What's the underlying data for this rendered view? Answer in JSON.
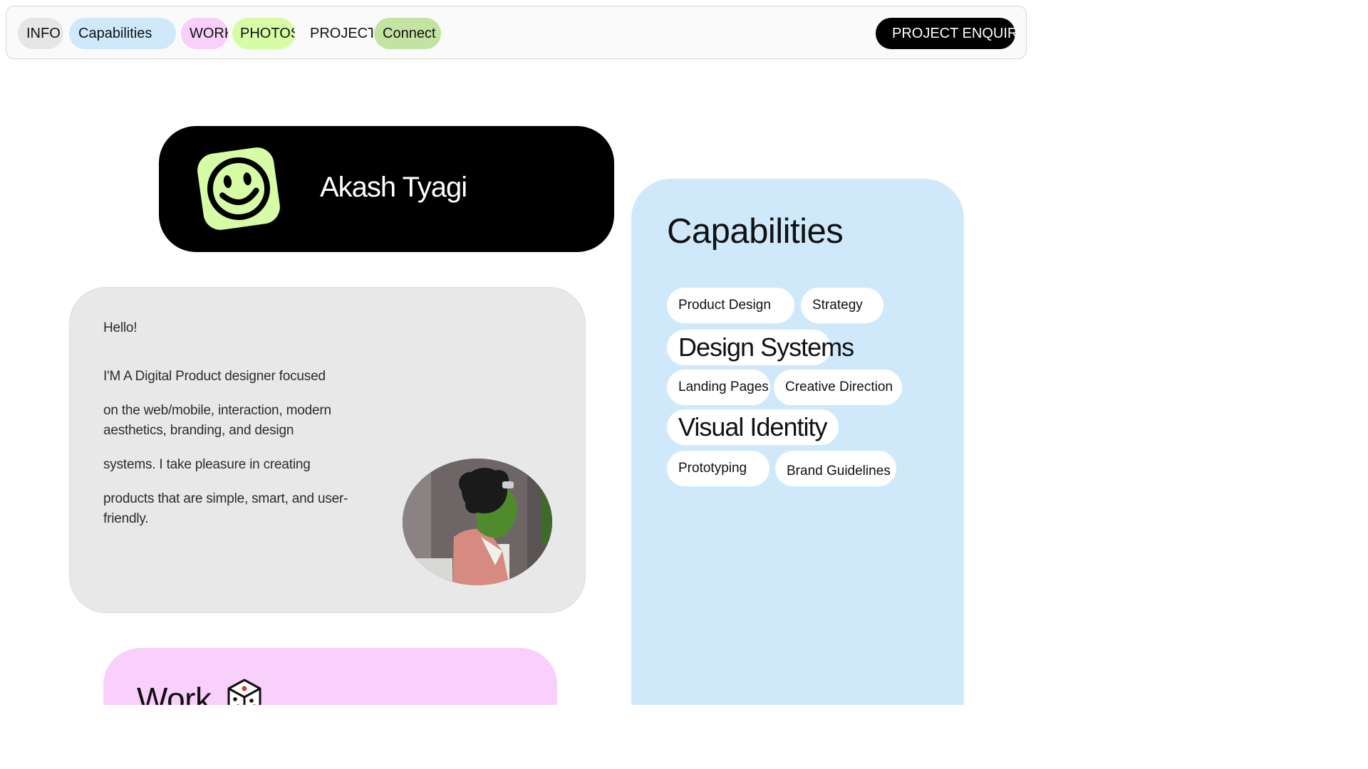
{
  "nav": {
    "items": [
      {
        "label": "INFO",
        "color": "#e6e6e6"
      },
      {
        "label": "Capabilities",
        "color": "#cfe9fb"
      },
      {
        "label": "WORK",
        "color": "#f9cffc"
      },
      {
        "label": "PHOTOS",
        "color": "#d6fca6"
      },
      {
        "label": "PROJECTS",
        "color": "transparent"
      },
      {
        "label": "Connect",
        "color": "#c4e3a3"
      }
    ],
    "cta_label": "PROJECT ENQUIRY"
  },
  "profile": {
    "name": "Akash Tyagi",
    "logo_icon": "smiley-face-icon",
    "logo_color": "#d6fca6"
  },
  "intro": {
    "greeting": "Hello!",
    "paragraphs": [
      "I'M A Digital Product designer focused",
      "on the web/mobile, interaction, modern aesthetics, branding, and design",
      "systems. I take pleasure in creating",
      "products that are simple, smart, and user-friendly."
    ],
    "avatar_icon": "kermit-avatar-image"
  },
  "work": {
    "title": "Work",
    "icon": "dice-icon"
  },
  "capabilities": {
    "title": "Capabilities",
    "tags": [
      "Product Design",
      "Strategy",
      "Design Systems",
      "Landing Pages",
      "Creative Direction",
      "Visual Identity",
      "Prototyping",
      "Brand Guidelines"
    ]
  },
  "colors": {
    "info_bg": "#e6e6e6",
    "capabilities_bg": "#cfe9fb",
    "work_bg": "#f9cffc",
    "accent_green": "#d6fca6",
    "cta_bg": "#000000"
  }
}
